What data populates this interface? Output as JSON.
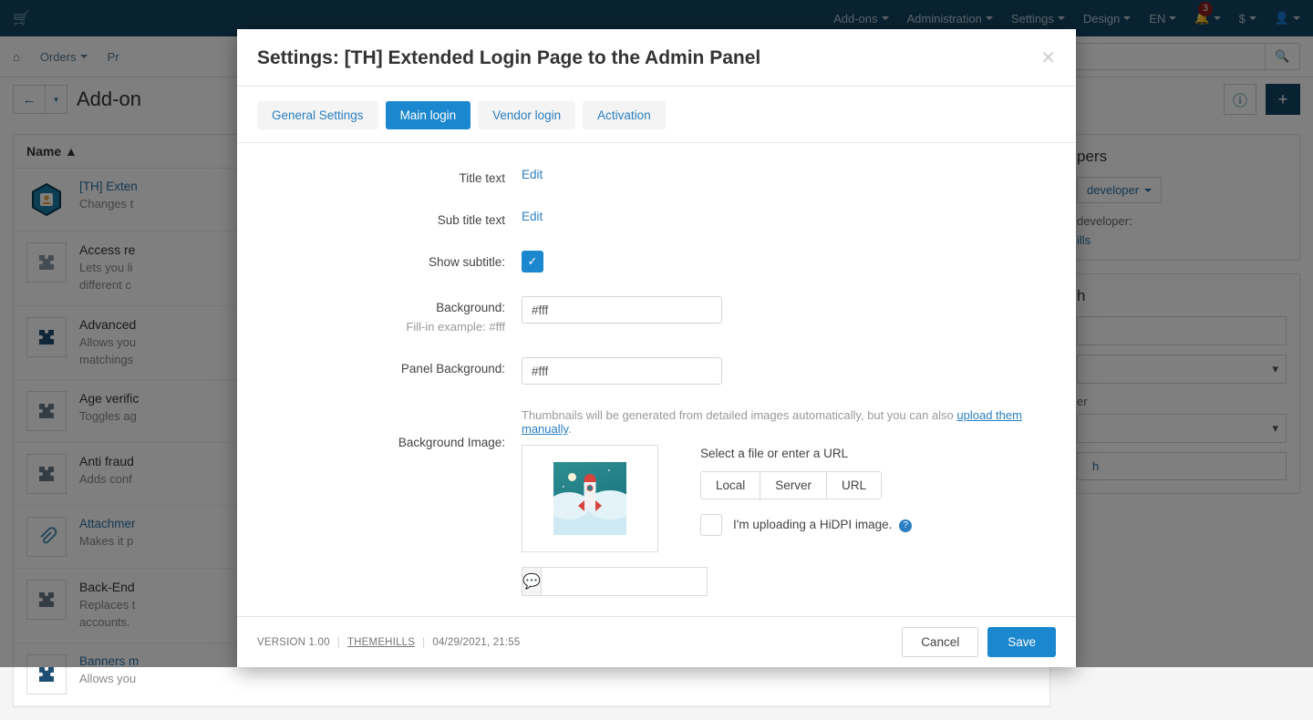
{
  "topbar": {
    "cart_icon": "cart-icon",
    "items": [
      {
        "label": "Add-ons",
        "caret": true
      },
      {
        "label": "Administration",
        "caret": true
      },
      {
        "label": "Settings",
        "caret": true
      },
      {
        "label": "Design",
        "caret": true
      },
      {
        "label": "EN",
        "caret": true
      }
    ],
    "notifications": {
      "icon": "bell-icon",
      "count": "3"
    },
    "currency": {
      "label": "$"
    },
    "user": {
      "icon": "user-icon"
    }
  },
  "subnav": {
    "home_icon": "home-icon",
    "items": [
      {
        "label": "Orders"
      },
      {
        "label": "Pr"
      }
    ],
    "search": {
      "value": "",
      "placeholder": "",
      "icon": "search-icon"
    }
  },
  "pagehead": {
    "back_icon": "arrow-left-icon",
    "caret_icon": "chevron-down-icon",
    "title": "Add-on",
    "help_icon": "question-icon",
    "add_icon": "plus-icon"
  },
  "list": {
    "column_header": "Name",
    "sort_icon": "sort-asc-icon",
    "rows": [
      {
        "icon": "addon-hex-icon",
        "name": "[TH] Exten",
        "desc": "Changes t",
        "active": true
      },
      {
        "icon": "puzzle-icon",
        "name": "Access re",
        "desc": "Lets you li\ndifferent c",
        "active": false
      },
      {
        "icon": "puzzle-icon",
        "name": "Advanced",
        "desc": "Allows you\nmatchings",
        "active": false
      },
      {
        "icon": "puzzle-icon",
        "name": "Age verific",
        "desc": "Toggles ag",
        "active": false
      },
      {
        "icon": "puzzle-icon",
        "name": "Anti fraud",
        "desc": "Adds conf",
        "active": false
      },
      {
        "icon": "paperclip-icon",
        "name": "Attachmer",
        "desc": "Makes it p",
        "active": true
      },
      {
        "icon": "puzzle-icon",
        "name": "Back-End",
        "desc": "Replaces t\naccounts.",
        "active": false
      },
      {
        "icon": "puzzle-icon",
        "name": "Banners m",
        "desc": "Allows you",
        "active": true
      }
    ]
  },
  "sidebar": {
    "developers_title": "pers",
    "developer_select": "developer",
    "developer_label": "developer:",
    "developer_link": "ills",
    "search_title": "h",
    "search_input": "",
    "select_one": "",
    "select_label": "er",
    "select_two": "",
    "search_button": "h"
  },
  "modal": {
    "title": "Settings: [TH] Extended Login Page to the Admin Panel",
    "close_icon": "close-icon",
    "tabs": [
      {
        "label": "General Settings",
        "active": false
      },
      {
        "label": "Main login",
        "active": true
      },
      {
        "label": "Vendor login",
        "active": false
      },
      {
        "label": "Activation",
        "active": false
      }
    ],
    "fields": {
      "title_text": {
        "label": "Title text",
        "action": "Edit"
      },
      "sub_title_text": {
        "label": "Sub title text",
        "action": "Edit"
      },
      "show_subtitle": {
        "label": "Show subtitle:",
        "checked": true,
        "check_icon": "check-icon"
      },
      "background": {
        "label": "Background:",
        "value": "#fff",
        "hint": "Fill-in example: #fff"
      },
      "panel_background": {
        "label": "Panel Background:",
        "value": "#fff"
      },
      "background_image": {
        "label": "Background Image:",
        "note_before": "Thumbnails will be generated from detailed images automatically, but you can also ",
        "note_link": "upload them manually",
        "note_after": ".",
        "thumbnail_alt": "rocket-launch-thumbnail",
        "select_title": "Select a file or enter a URL",
        "source_buttons": [
          "Local",
          "Server",
          "URL"
        ],
        "hidpi_label": "I'm uploading a HiDPI image.",
        "hidpi_checked": false,
        "hidpi_help_icon": "question-icon",
        "alt_text_icon": "comment-icon",
        "alt_text_value": ""
      }
    },
    "footer": {
      "version": "VERSION 1.00",
      "brand": "THEMEHILLS",
      "timestamp": "04/29/2021, 21:55",
      "cancel": "Cancel",
      "save": "Save"
    }
  },
  "colors": {
    "accent": "#1b87ce",
    "topbar": "#134563",
    "link": "#2b7fc0",
    "badge": "#8a1f1f"
  }
}
